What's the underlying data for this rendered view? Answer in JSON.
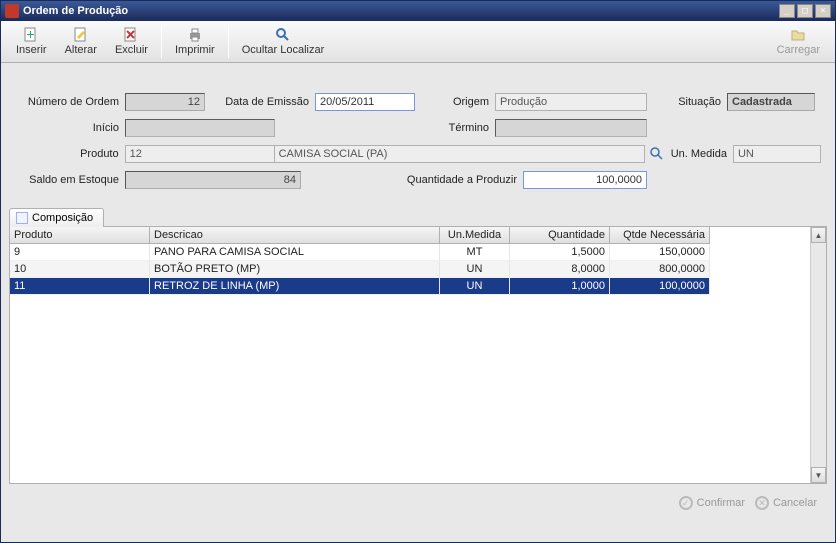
{
  "window": {
    "title": "Ordem de Produção"
  },
  "toolbar": {
    "inserir": "Inserir",
    "alterar": "Alterar",
    "excluir": "Excluir",
    "imprimir": "Imprimir",
    "ocultar_localizar": "Ocultar Localizar",
    "carregar": "Carregar"
  },
  "form": {
    "labels": {
      "numero": "Número de Ordem",
      "data_emissao": "Data de Emissão",
      "origem": "Origem",
      "situacao": "Situação",
      "inicio": "Início",
      "termino": "Término",
      "produto": "Produto",
      "un_medida": "Un. Medida",
      "saldo_estoque": "Saldo em Estoque",
      "qtd_produzir": "Quantidade a Produzir"
    },
    "values": {
      "numero": "12",
      "data_emissao": "20/05/2011",
      "origem": "Produção",
      "situacao": "Cadastrada",
      "inicio": "",
      "termino": "",
      "produto_cod": "12",
      "produto_desc": "CAMISA SOCIAL (PA)",
      "un_medida": "UN",
      "saldo_estoque": "84",
      "qtd_produzir": "100,0000"
    }
  },
  "tabs": {
    "composicao": "Composição"
  },
  "grid": {
    "headers": {
      "produto": "Produto",
      "descricao": "Descricao",
      "un": "Un.Medida",
      "qty": "Quantidade",
      "need": "Qtde Necessária"
    },
    "rows": [
      {
        "produto": "9",
        "descricao": "PANO PARA CAMISA SOCIAL",
        "un": "MT",
        "qty": "1,5000",
        "need": "150,0000",
        "selected": false
      },
      {
        "produto": "10",
        "descricao": "BOTÃO PRETO (MP)",
        "un": "UN",
        "qty": "8,0000",
        "need": "800,0000",
        "selected": false
      },
      {
        "produto": "11",
        "descricao": "RETROZ DE LINHA (MP)",
        "un": "UN",
        "qty": "1,0000",
        "need": "100,0000",
        "selected": true
      }
    ]
  },
  "footer": {
    "confirmar": "Confirmar",
    "cancelar": "Cancelar"
  }
}
